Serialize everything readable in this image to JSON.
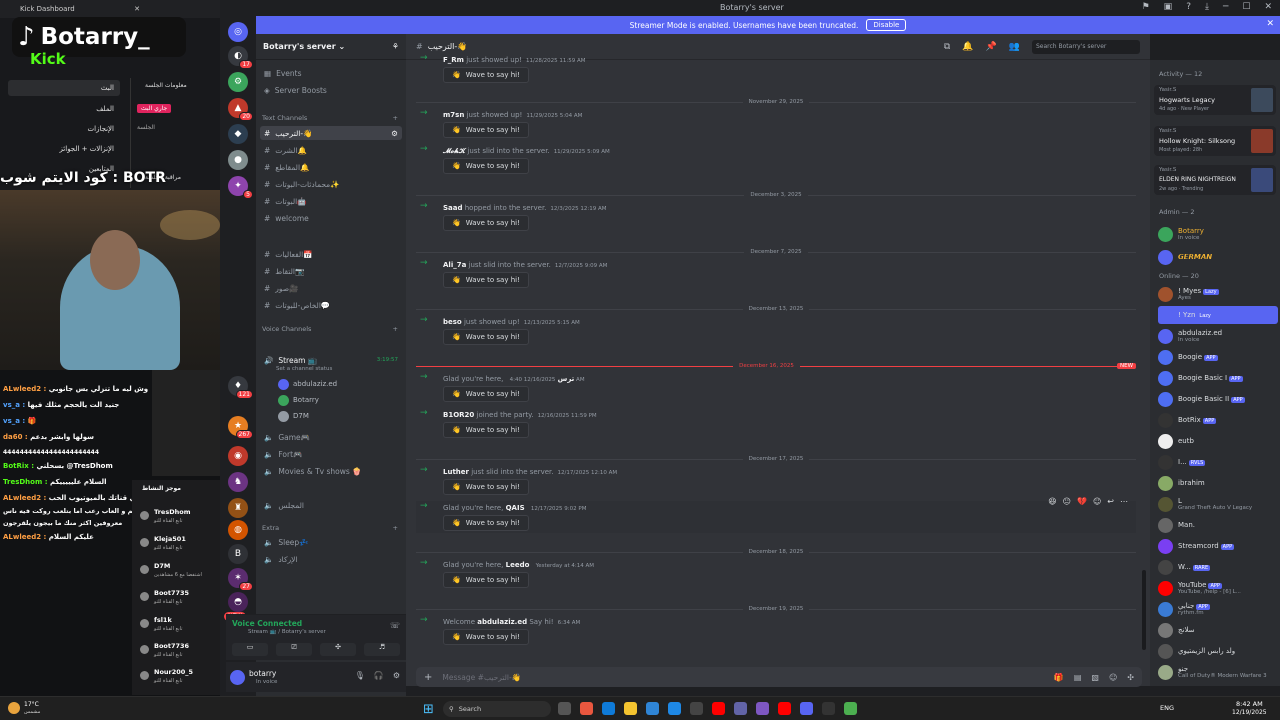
{
  "window": {
    "title": "Botarry's server",
    "browser_tab": "Kick Dashboard"
  },
  "banner": {
    "text": "Streamer Mode is enabled. Usernames have been truncated.",
    "button": "Disable"
  },
  "server": {
    "name": "Botarry's server",
    "events": "Events",
    "boosts": "Server Boosts"
  },
  "channel_header": {
    "name": "الترحيب-👋",
    "search_placeholder": "Search Botarry's server"
  },
  "text_channels_label": "Text Channels",
  "text_channels": [
    "الترحيب-👋",
    "الشرت🔔",
    "المقاطع🔔",
    "محمادثات-البوتات✨",
    "البوتات🤖",
    "welcome"
  ],
  "other_channels": [
    "الفعاليات📅",
    "التقاط📷",
    "صور🎥",
    "الخاص-للبوتات💬"
  ],
  "voice_channels_label": "Voice Channels",
  "voice_channels": {
    "stream": "Stream 📺",
    "stream_status": "Set a channel status",
    "stream_time": "3:19:57",
    "stream_users": [
      "abdulaziz.ed",
      "Botarry",
      "D7M"
    ],
    "others": [
      "Game🎮",
      "Fort🎮",
      "Movies & Tv shows 🍿",
      "المجلس"
    ]
  },
  "extra_label": "Extra",
  "extra_channels": [
    "Sleep💤",
    "الإركاد"
  ],
  "voice_status": {
    "title": "Voice Connected",
    "sub": "Stream 📺 / Botarry's server"
  },
  "user": {
    "name": "botarry",
    "status": "In voice"
  },
  "messages": [
    {
      "date": "",
      "user": "F_Rm",
      "text": "just showed up!",
      "ts": "11/28/2025 11:59 AM"
    },
    {
      "date": "November 29, 2025",
      "user": "m7sn",
      "text": "just showed up!",
      "ts": "11/29/2025 5:04 AM"
    },
    {
      "date": "",
      "user": "𝓜𝓸𝓱𝓚",
      "text": "just slid into the server.",
      "ts": "11/29/2025 5:09 AM"
    },
    {
      "date": "December 3, 2025",
      "user": "Saad",
      "text": "hopped into the server.",
      "ts": "12/3/2025 12:19 AM"
    },
    {
      "date": "December 7, 2025",
      "user": "Ali_7a",
      "text": "just slid into the server.",
      "ts": "12/7/2025 9:09 AM"
    },
    {
      "date": "December 13, 2025",
      "user": "beso",
      "text": "just showed up!",
      "ts": "12/13/2025 5:15 AM"
    },
    {
      "date": "December 16, 2025",
      "user": "ترس",
      "pre": "Glad you're here,",
      "text": "",
      "ts": "12/16/2025 4:40 AM"
    },
    {
      "date": "",
      "user": "B1OR20",
      "text": "joined the party.",
      "ts": "12/16/2025 11:59 PM"
    },
    {
      "date": "December 17, 2025",
      "user": "Luther",
      "text": "just slid into the server.",
      "ts": "12/17/2025 12:10 AM"
    },
    {
      "date": "",
      "user": "QAIS",
      "pre": "Glad you're here,",
      "text": "",
      "ts": "12/17/2025 9:02 PM"
    },
    {
      "date": "December 18, 2025",
      "user": "Leedo",
      "pre": "Glad you're here,",
      "text": "",
      "ts": "Yesterday at 4:14 AM"
    },
    {
      "date": "December 19, 2025",
      "user": "abdulaziz.ed",
      "pre": "Welcome",
      "text": "Say hi!",
      "ts": "6:34 AM"
    }
  ],
  "wave_label": "Wave to say hi!",
  "new_badge": "NEW",
  "composer": {
    "placeholder": "Message #الترحيب-👋"
  },
  "members": {
    "activity_label": "Activity — 12",
    "activities": [
      {
        "user": "Yasir.S",
        "game": "Hogwarts Legacy",
        "meta": "4d ago · New Player"
      },
      {
        "user": "Yasir.S",
        "game": "Hollow Knight: Silksong",
        "meta": "Most played: 28h"
      },
      {
        "user": "Yasir.S",
        "game": "ELDEN RING NIGHTREIGN",
        "meta": "2w ago · Trending"
      }
    ],
    "admin_label": "Admin — 2",
    "admins": [
      {
        "name": "Botarry",
        "status": "In voice"
      },
      {
        "name": "𝙂𝙀𝙍𝙈𝘼𝙉",
        "status": ""
      }
    ],
    "online_label": "Online — 20",
    "online": [
      {
        "name": "! Myes",
        "status": "Ayes",
        "tag": "Lazy"
      },
      {
        "name": "! Yzn",
        "status": "",
        "tag": "Lazy"
      },
      {
        "name": "abdulaziz.ed",
        "status": "In voice",
        "tag": ""
      },
      {
        "name": "Boogie",
        "status": "",
        "tag": "APP"
      },
      {
        "name": "Boogie Basic I",
        "status": "",
        "tag": "APP"
      },
      {
        "name": "Boogie Basic II",
        "status": "",
        "tag": "APP"
      },
      {
        "name": "BotRix",
        "status": "",
        "tag": "APP"
      },
      {
        "name": "eutb",
        "status": "",
        "tag": ""
      },
      {
        "name": "I...",
        "status": "",
        "tag": "RVLS"
      },
      {
        "name": "ibrahim",
        "status": "",
        "tag": ""
      },
      {
        "name": "L",
        "status": "Grand Theft Auto V Legacy",
        "tag": ""
      },
      {
        "name": "Man.",
        "status": "",
        "tag": ""
      },
      {
        "name": "Streamcord",
        "status": "",
        "tag": "APP"
      },
      {
        "name": "W...",
        "status": "",
        "tag": "RARE"
      },
      {
        "name": "YouTube",
        "status": "YouTube, /help - [6] L...",
        "tag": "APP"
      },
      {
        "name": "جنابي",
        "status": "rythm.fm",
        "tag": "APP"
      },
      {
        "name": "سلانج",
        "status": "",
        "tag": ""
      },
      {
        "name": "ولد رابس الزيمتيوي",
        "status": "",
        "tag": ""
      },
      {
        "name": "جنو",
        "status": "Call of Duty® Modern Warfare 3",
        "tag": ""
      }
    ]
  },
  "overlay": {
    "tiktok": "Botarry_",
    "kick_brand": "Kick",
    "kick_menu": [
      "البث",
      "الملف",
      "الإنجازات",
      "الإنزالات + الجوائز",
      "المتابعين"
    ],
    "kick_side": [
      "معلومات الجلسة",
      "جاري البث",
      "الجلسة",
      "مراقبة الجلسة"
    ],
    "code_text": "كود الايتم شوب : BOTR",
    "chat": [
      {
        "user": "ALwleed2 :",
        "msg": "وش ليه ما تنزلي بس جانوبي"
      },
      {
        "user": "vs_a :",
        "msg": "جنيد الت يالحجم مثلك فيها"
      },
      {
        "user": "vs_a :",
        "msg": "🎁"
      },
      {
        "user": "da60 :",
        "msg": "سولها وابشر بدعم"
      },
      {
        "user": "",
        "msg": "44444444444444444444444"
      },
      {
        "user": "BotRix :",
        "msg": "بسحلني @TresDhom"
      },
      {
        "user": "TresDhom :",
        "msg": "السلام عليييييكم"
      },
      {
        "user": "ALwleed2 :",
        "msg": "اسمع خلي قناتك بالميوتيوب الحب"
      },
      {
        "user": "",
        "msg": "لعباب تشكيم و العاب رعب اما بتلعب روكت فيه ناس"
      },
      {
        "user": "",
        "msg": "معروفين اكثر منك ما بيجون يلقرجون"
      },
      {
        "user": "ALwleed2 :",
        "msg": "عليكم السلام"
      }
    ],
    "spam_title": "موجز النشاط",
    "spam": [
      {
        "name": "TresDhom",
        "sub": "تابع القناة للتو"
      },
      {
        "name": "Kleja501",
        "sub": "تابع القناة للتو"
      },
      {
        "name": "D7M",
        "sub": "اشتفضا مع 6 مشاهدين"
      },
      {
        "name": "Boot7735",
        "sub": "تابع القناة للتو"
      },
      {
        "name": "fsl1k",
        "sub": "تابع القناة للتو"
      },
      {
        "name": "Boot7736",
        "sub": "تابع القناة للتو"
      },
      {
        "name": "Nour200_5",
        "sub": "تابع القناة للتو"
      }
    ]
  },
  "taskbar": {
    "weather_temp": "17°C",
    "weather_desc": "مشمس",
    "search": "Search",
    "time": "8:42 AM",
    "date": "12/19/2025",
    "lang": "ENG"
  },
  "guild_badges": [
    "17",
    "20",
    "5",
    "121",
    "267",
    "27"
  ]
}
